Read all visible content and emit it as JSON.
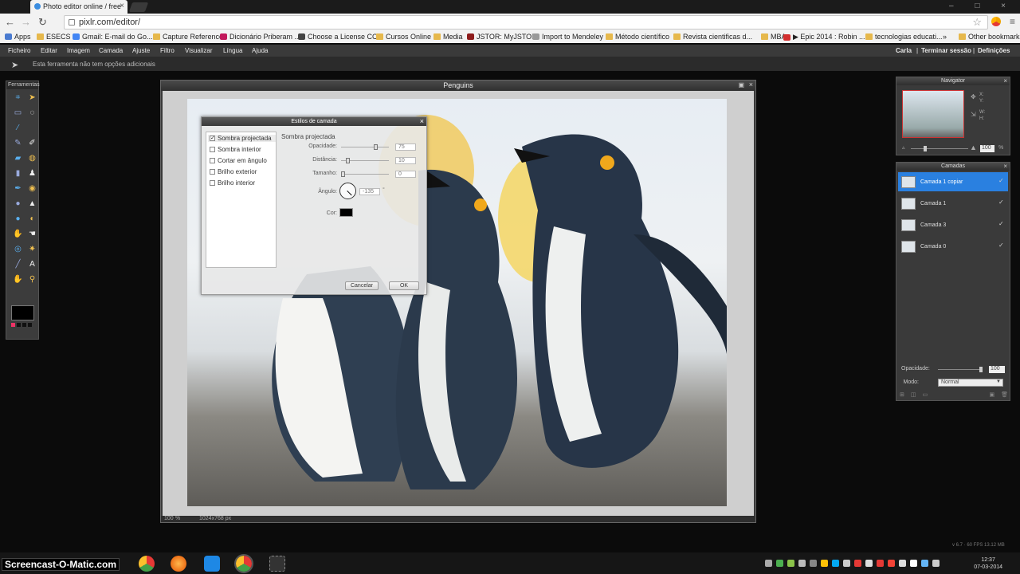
{
  "browser": {
    "tab_title": "Photo editor online / free",
    "tab_close": "×",
    "url": "pixlr.com/editor/",
    "window_controls": "– □ ×",
    "nav": {
      "back": "←",
      "forward": "→",
      "reload": "↻"
    },
    "star": "☆",
    "menu": "≡"
  },
  "bookmarks": [
    {
      "label": "Apps",
      "icon": "apps-icon"
    },
    {
      "label": "ESECS",
      "icon": "folder-icon"
    },
    {
      "label": "Gmail: E-mail do Go...",
      "icon": "google-icon"
    },
    {
      "label": "Capture Reference",
      "icon": "folder-icon"
    },
    {
      "label": "Dicionário Priberam ...",
      "icon": "priberam-icon"
    },
    {
      "label": "Choose a License CC",
      "icon": "cc-icon"
    },
    {
      "label": "Cursos Online",
      "icon": "folder-icon"
    },
    {
      "label": "Media",
      "icon": "folder-icon"
    },
    {
      "label": "JSTOR: MyJSTOR",
      "icon": "jstor-icon"
    },
    {
      "label": "Import to Mendeley",
      "icon": "page-icon"
    },
    {
      "label": "Método científico",
      "icon": "folder-icon"
    },
    {
      "label": "Revista cientificas d...",
      "icon": "folder-icon"
    },
    {
      "label": "MBA",
      "icon": "folder-icon"
    },
    {
      "label": "▶ Epic 2014 : Robin ...",
      "icon": "youtube-icon"
    },
    {
      "label": "tecnologias educati...",
      "icon": "folder-icon"
    },
    {
      "label": "»",
      "icon": ""
    },
    {
      "label": "Other bookmarks",
      "icon": "folder-icon"
    }
  ],
  "menubar": {
    "items": [
      "Ficheiro",
      "Editar",
      "Imagem",
      "Camada",
      "Ajuste",
      "Filtro",
      "Visualizar",
      "Língua",
      "Ajuda"
    ],
    "right": [
      "Carla",
      "Terminar sessão",
      "Definições"
    ]
  },
  "optionbar": {
    "text": "Esta ferramenta não tem opções adicionais"
  },
  "tools_panel": {
    "title": "Ferramentas"
  },
  "image_window": {
    "title": "Penguins",
    "zoom": "100",
    "size": "1024x768 px"
  },
  "dialog": {
    "title": "Estilos de camada",
    "close": "×",
    "styles": [
      {
        "label": "Sombra projectada",
        "checked": true
      },
      {
        "label": "Sombra interior",
        "checked": false
      },
      {
        "label": "Cortar em ângulo",
        "checked": false
      },
      {
        "label": "Brilho exterior",
        "checked": false
      },
      {
        "label": "Brilho interior",
        "checked": false
      }
    ],
    "section_title": "Sombra projectada",
    "opacity": {
      "label": "Opacidade:",
      "value": "75"
    },
    "distance": {
      "label": "Distância:",
      "value": "10"
    },
    "size": {
      "label": "Tamanho:",
      "value": "0"
    },
    "angle": {
      "label": "Ângulo:",
      "value": "-135",
      "unit": "°"
    },
    "color": {
      "label": "Cor:",
      "value": "#000000"
    },
    "cancel": "Cancelar",
    "ok": "OK"
  },
  "navigator": {
    "title": "Navigator",
    "x": "X:",
    "y": "Y:",
    "w": "W:",
    "h": "H:",
    "zoom": "100",
    "unit": "%"
  },
  "layers": {
    "title": "Camadas",
    "items": [
      {
        "label": "Camada 1 copiar",
        "selected": true
      },
      {
        "label": "Camada 1",
        "selected": false
      },
      {
        "label": "Camada 3",
        "selected": false
      },
      {
        "label": "Camada 0",
        "selected": false
      }
    ],
    "opacity_label": "Opacidade:",
    "opacity_value": "100",
    "mode_label": "Modo:",
    "mode_value": "Normal"
  },
  "taskbar": {
    "watermark": "Screencast-O-Matic.com",
    "time": "12:37",
    "date": "07-03-2014",
    "version_text": "v 6.7 · 60 FPS 13.12 MB"
  }
}
